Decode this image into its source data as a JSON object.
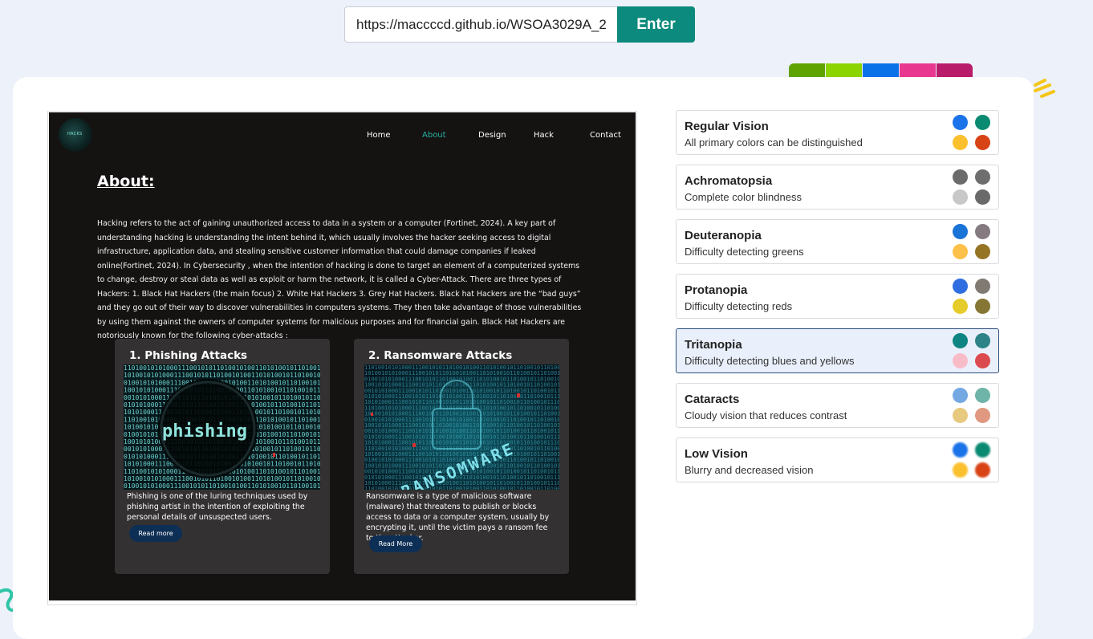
{
  "url_bar": {
    "value": "https://maccccd.github.io/WSOA3029A_2",
    "enter_label": "Enter"
  },
  "palette": [
    "#5ea300",
    "#8cd400",
    "#0a72e8",
    "#e8388f",
    "#b81c6b"
  ],
  "site": {
    "logo_text": "HACKS",
    "nav": [
      "Home",
      "About",
      "Design",
      "Hack",
      "Contact"
    ],
    "active_nav": "About",
    "about_title": "About:",
    "about_text": "Hacking refers to the act of gaining unauthorized access to data in a system or a computer (Fortinet, 2024). A key part of understanding hacking is understanding the intent behind it, which usually involves the hacker seeking access to digital infrastructure, application data, and stealing sensitive customer information that could damage companies if leaked online(Fortinet, 2024). In Cybersecurity , when the intention of hacking is done to target an element of a computerized systems to change, destroy or steal data as well as exploit or harm the network, it is called a Cyber-Attack. There are three types of Hackers: 1. Black Hat Hackers (the main focus) 2. White Hat Hackers 3. Grey Hat Hackers. Black hat Hackers are the “bad guys” and they go out of their way to discover vulnerabilities in computers systems. They then take advantage of those vulnerabilities by using them against the owners of computer systems for malicious purposes and for financial gain. Black Hat Hackers are notoriously known for the following cyber-attacks :",
    "cards": [
      {
        "title": "1. Phishing Attacks",
        "image_word": "phishing",
        "description": "Phishing is one of the luring techniques used by phishing artist in the intention of exploiting the personal details of unsuspected users.",
        "button": "Read more"
      },
      {
        "title": "2. Ransomware Attacks",
        "image_word": "RANSOMWARE",
        "description": "Ransomware is a type of malicious software (malware) that threatens to publish or blocks access to data or a computer system, usually by encrypting it, until the victim pays a ransom fee to the attacker.",
        "button": "Read More"
      }
    ]
  },
  "vision_types": [
    {
      "title": "Regular Vision",
      "desc": "All primary colors can be distinguished",
      "colors": [
        "#1a73e8",
        "#0b8a72",
        "#fbc02d",
        "#d84315"
      ]
    },
    {
      "title": "Achromatopsia",
      "desc": "Complete color blindness",
      "colors": [
        "#6b6b6b",
        "#6e6e6e",
        "#c8c8c8",
        "#6a6a6a"
      ]
    },
    {
      "title": "Deuteranopia",
      "desc": "Difficulty detecting greens",
      "colors": [
        "#1a73d6",
        "#847a80",
        "#fdc04a",
        "#957424"
      ]
    },
    {
      "title": "Protanopia",
      "desc": "Difficulty detecting reds",
      "colors": [
        "#2f6ee0",
        "#817a73",
        "#e6cc2a",
        "#857634"
      ]
    },
    {
      "title": "Tritanopia",
      "desc": "Difficulty detecting blues and yellows",
      "colors": [
        "#0e8582",
        "#2e8388",
        "#f8bcc8",
        "#db4a4e"
      ]
    },
    {
      "title": "Cataracts",
      "desc": "Cloudy vision that reduces contrast",
      "colors": [
        "#74a8e2",
        "#6fb4a8",
        "#e8c980",
        "#e09880"
      ]
    },
    {
      "title": "Low Vision",
      "desc": "Blurry and decreased vision",
      "colors": [
        "#1a73e8",
        "#0b8a72",
        "#fbc02d",
        "#d84315"
      ]
    }
  ],
  "selected_vision": "Tritanopia"
}
